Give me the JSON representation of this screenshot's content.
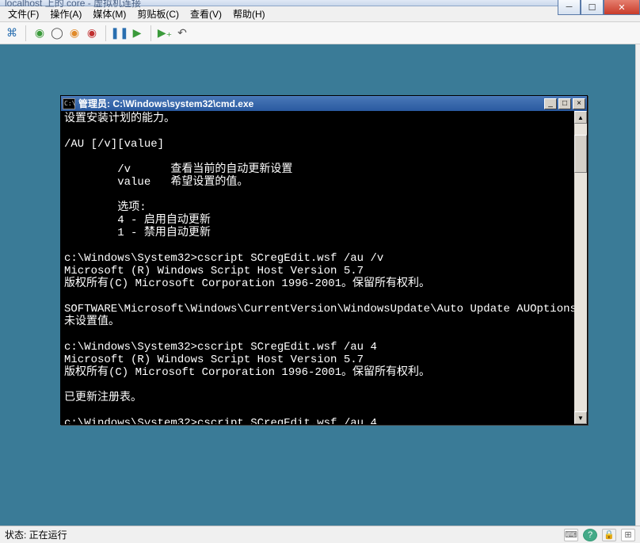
{
  "outer": {
    "title": "localhost 上的 core - 虚拟机连接"
  },
  "menu": {
    "items": [
      "文件(F)",
      "操作(A)",
      "媒体(M)",
      "剪贴板(C)",
      "查看(V)",
      "帮助(H)"
    ]
  },
  "cmd": {
    "icon_text": "C:\\",
    "title": "管理员: C:\\Windows\\system32\\cmd.exe",
    "content": "设置安装计划的能力。\n\n/AU [/v][value]\n\n        /v      查看当前的自动更新设置\n        value   希望设置的值。\n\n        选项:\n        4 - 启用自动更新\n        1 - 禁用自动更新\n\nc:\\Windows\\System32>cscript SCregEdit.wsf /au /v\nMicrosoft (R) Windows Script Host Version 5.7\n版权所有(C) Microsoft Corporation 1996-2001。保留所有权利。\n\nSOFTWARE\\Microsoft\\Windows\\CurrentVersion\\WindowsUpdate\\Auto Update AUOptions\n未设置值。\n\nc:\\Windows\\System32>cscript SCregEdit.wsf /au 4\nMicrosoft (R) Windows Script Host Version 5.7\n版权所有(C) Microsoft Corporation 1996-2001。保留所有权利。\n\n已更新注册表。\n\nc:\\Windows\\System32>cscript SCregEdit.wsf /au 4"
  },
  "status": {
    "text": "状态: 正在运行"
  }
}
